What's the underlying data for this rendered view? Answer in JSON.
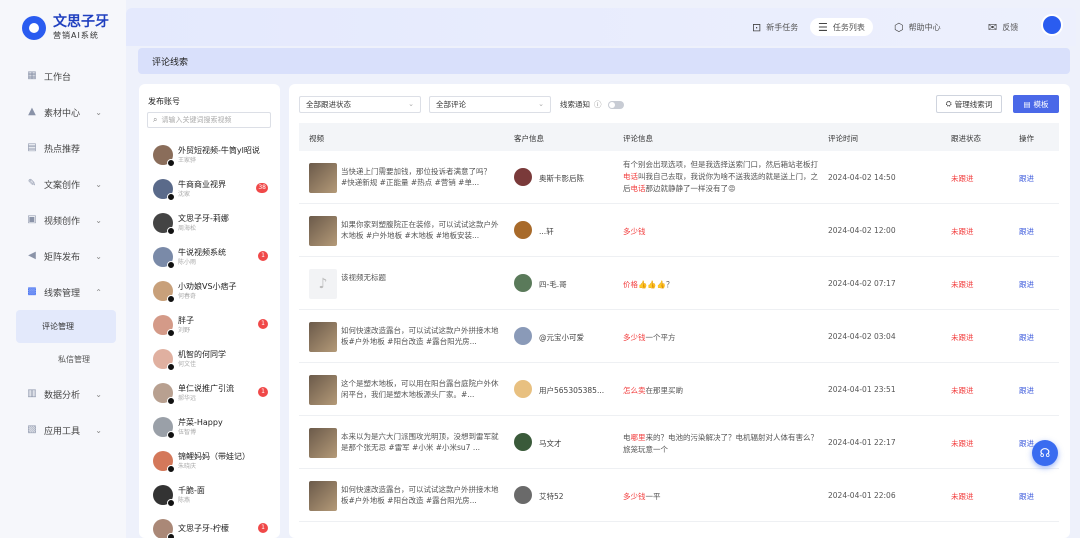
{
  "brand": {
    "name": "文思子牙",
    "sub": "营销AI系统"
  },
  "nav": {
    "items": [
      {
        "label": "工作台",
        "icon": "dashboard-icon"
      },
      {
        "label": "素材中心",
        "icon": "image-icon"
      },
      {
        "label": "热点推荐",
        "icon": "hot-icon"
      },
      {
        "label": "文案创作",
        "icon": "pen-icon"
      },
      {
        "label": "视频创作",
        "icon": "video-icon"
      },
      {
        "label": "矩阵发布",
        "icon": "send-icon"
      },
      {
        "label": "线索管理",
        "icon": "leads-icon"
      },
      {
        "label": "数据分析",
        "icon": "chart-icon"
      },
      {
        "label": "应用工具",
        "icon": "tool-icon"
      }
    ],
    "sub": {
      "comment": "评论管理",
      "message": "私信管理"
    }
  },
  "topbar": {
    "guide": "新手任务",
    "tasks": "任务列表",
    "help": "帮助中心",
    "feedback": "反馈"
  },
  "page_title": "评论线索",
  "accounts": {
    "title": "发布账号",
    "search_placeholder": "请输入关键词搜索视频",
    "items": [
      {
        "name": "外贸短视频-牛筒yl昭说",
        "sub": "王家骅",
        "badge": ""
      },
      {
        "name": "牛商商业视界",
        "sub": "沈家",
        "badge": "38"
      },
      {
        "name": "文思子牙-莉娜",
        "sub": "周海松",
        "badge": ""
      },
      {
        "name": "牛说视频系统",
        "sub": "陈小雨",
        "badge": "1"
      },
      {
        "name": "小劝娘VS小痞子",
        "sub": "何春奇",
        "badge": ""
      },
      {
        "name": "胖子",
        "sub": "刘野",
        "badge": "1"
      },
      {
        "name": "机智的何同学",
        "sub": "何文佳",
        "badge": ""
      },
      {
        "name": "单仁说推广引流",
        "sub": "郝华远",
        "badge": "1"
      },
      {
        "name": "芹菜-Happy",
        "sub": "伍智博",
        "badge": ""
      },
      {
        "name": "锦鲤妈妈（带娃记）",
        "sub": "朱晓庆",
        "badge": ""
      },
      {
        "name": "千脆-面",
        "sub": "陈燕",
        "badge": ""
      },
      {
        "name": "文思子牙-柠檬",
        "sub": "",
        "badge": "1"
      }
    ]
  },
  "filters": {
    "status": "全部跟进状态",
    "comment": "全部评论",
    "notify": "线索通知",
    "manage": "管理线索词",
    "template": "模板"
  },
  "table": {
    "headers": {
      "video": "视频",
      "customer": "客户信息",
      "comment": "评论信息",
      "time": "评论时间",
      "status": "跟进状态",
      "op": "操作"
    },
    "rows": [
      {
        "video": "当快递上门需要加钱，那位投诉者满意了吗？ #快递新规 #正能量 #热点 #营销 #单...",
        "customer": "奥斯卡影后陈",
        "comment_a": "有个别会出现选项，但是我选择送索门口，然后箱站老板打",
        "comment_r": "电话",
        "comment_b": "叫我自己去取，我说你为啥不送我选的就是送上门，之后",
        "comment_r2": "电话",
        "comment_c": "那边就静静了一样没有了😡",
        "time": "2024-04-02 14:50",
        "status": "未跟进",
        "op": "跟进"
      },
      {
        "video": "如果你家到塑腹院正在装修，可以试试这款户外木地板 #户外地板 #木地板 #地板安装...",
        "customer": "...轩",
        "comment_a": "",
        "comment_r": "多少钱",
        "comment_b": "",
        "comment_r2": "",
        "comment_c": "",
        "time": "2024-04-02 12:00",
        "status": "未跟进",
        "op": "跟进"
      },
      {
        "video": "该视频无标题",
        "customer": "四-毛.哥",
        "comment_a": "",
        "comment_r": "价格",
        "comment_b": "👍👍👍？",
        "comment_r2": "",
        "comment_c": "",
        "time": "2024-04-02 07:17",
        "status": "未跟进",
        "op": "跟进"
      },
      {
        "video": "如何快速改造露台，可以试试这款户外拼接木地板#户外地板 #阳台改造 #露台阳光房...",
        "customer": "@元宝小可爱",
        "comment_a": "",
        "comment_r": "多少钱",
        "comment_b": "一个平方",
        "comment_r2": "",
        "comment_c": "",
        "time": "2024-04-02 03:04",
        "status": "未跟进",
        "op": "跟进"
      },
      {
        "video": "这个是塑木地板，可以用在阳台露台庭院户外休闲平台，我们是塑木地板源头厂家。#...",
        "customer": "用户565305385...",
        "comment_a": "",
        "comment_r": "怎么卖",
        "comment_b": "在那里买啲",
        "comment_r2": "",
        "comment_c": "",
        "time": "2024-04-01 23:51",
        "status": "未跟进",
        "op": "跟进"
      },
      {
        "video": "本来以为是六大门派围攻光明顶，没想到雷军就是那个张无忌 #雷军 #小米 #小米su7 ...",
        "customer": "马文才",
        "comment_a": "电",
        "comment_r": "哪里",
        "comment_b": "来的？电池的污染解决了？电机辐射对人体有害么？旅笼玩意一个",
        "comment_r2": "",
        "comment_c": "",
        "time": "2024-04-01 22:17",
        "status": "未跟进",
        "op": "跟进"
      },
      {
        "video": "如何快速改造露台，可以试试这款户外拼接木地板#户外地板 #阳台改造 #露台阳光房...",
        "customer": "艾特52",
        "comment_a": "",
        "comment_r": "多少钱",
        "comment_b": "一平",
        "comment_r2": "",
        "comment_c": "",
        "time": "2024-04-01 22:06",
        "status": "未跟进",
        "op": "跟进"
      }
    ]
  },
  "colors": {
    "accent": "#4a68e8",
    "red": "#f23c3c",
    "link": "#3d5bdc"
  }
}
